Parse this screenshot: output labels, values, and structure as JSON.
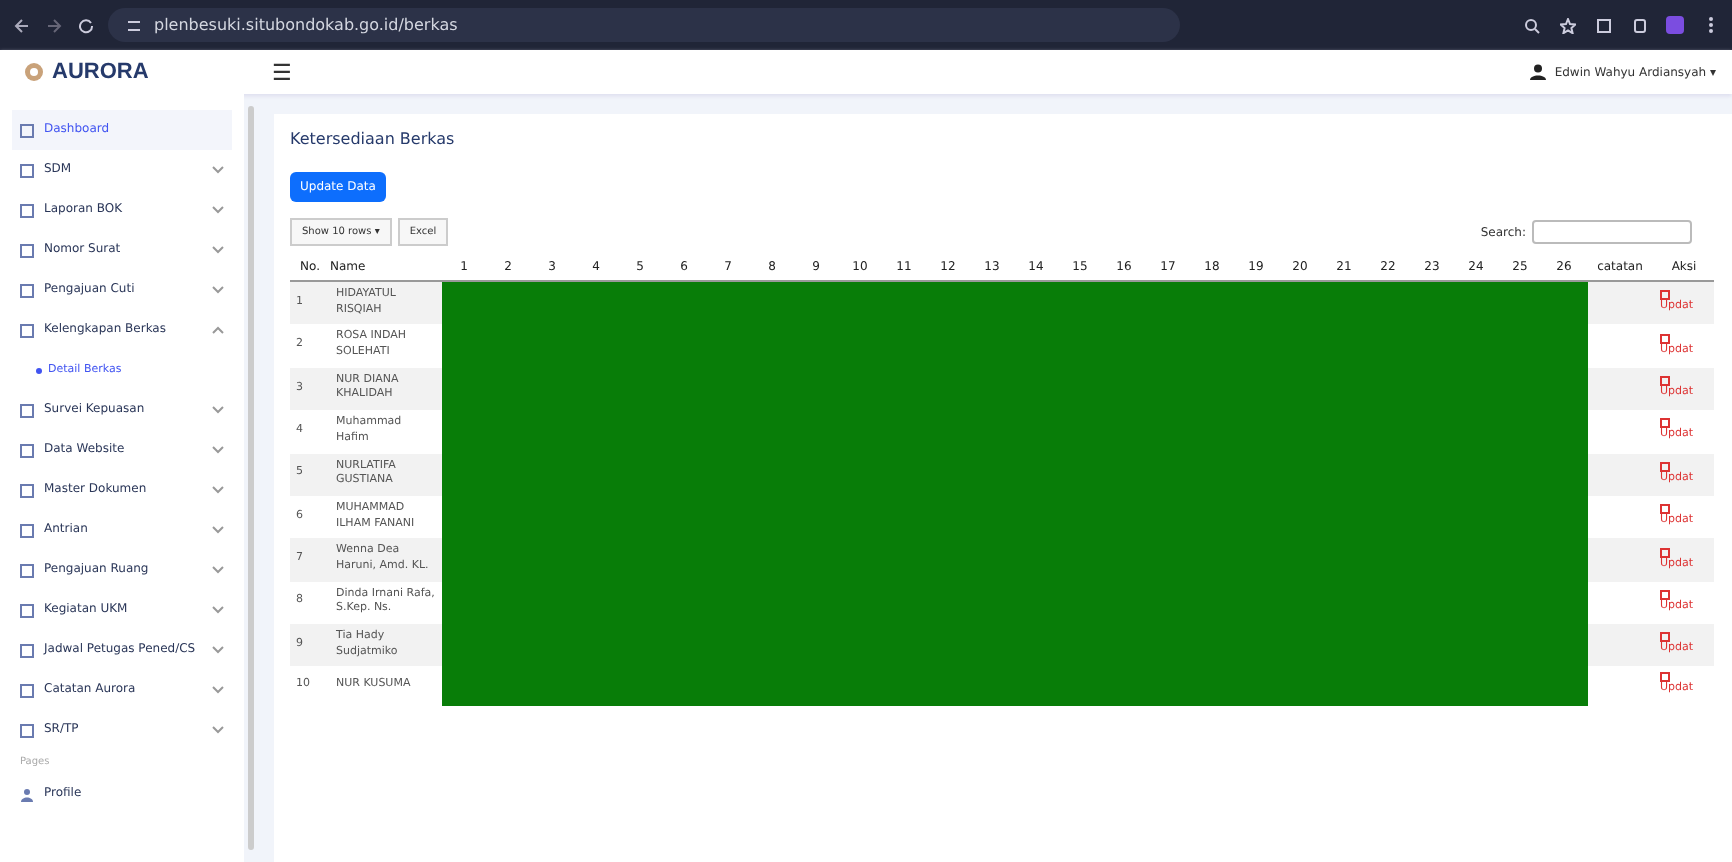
{
  "browser": {
    "url": "plenbesuki.situbondokab.go.id/berkas"
  },
  "app": {
    "logo": "AURORA",
    "menu_glyph": "☰",
    "user": "Edwin Wahyu Ardiansyah",
    "user_caret": "▾"
  },
  "sidebar": {
    "items": [
      {
        "label": "Dashboard",
        "selected": true
      },
      {
        "label": "SDM",
        "selected": false,
        "expanded": false
      },
      {
        "label": "Laporan BOK",
        "selected": false,
        "expanded": false
      },
      {
        "label": "Nomor Surat",
        "selected": false,
        "expanded": false
      },
      {
        "label": "Pengajuan Cuti",
        "selected": false,
        "expanded": false
      },
      {
        "label": "Kelengkapan Berkas",
        "selected": false,
        "expanded": true,
        "children": [
          {
            "label": "Detail Berkas",
            "selected": true
          }
        ]
      },
      {
        "label": "Survei Kepuasan",
        "selected": false,
        "expanded": false
      },
      {
        "label": "Data Website",
        "selected": false,
        "expanded": false
      },
      {
        "label": "Master Dokumen",
        "selected": false,
        "expanded": false
      },
      {
        "label": "Antrian",
        "selected": false,
        "expanded": false
      },
      {
        "label": "Pengajuan Ruang",
        "selected": false,
        "expanded": false
      },
      {
        "label": "Kegiatan UKM",
        "selected": false,
        "expanded": false
      },
      {
        "label": "Jadwal Petugas Pened/CS",
        "selected": false,
        "expanded": false
      },
      {
        "label": "Catatan Aurora",
        "selected": false,
        "expanded": false
      },
      {
        "label": "SR/TP",
        "selected": false,
        "expanded": false
      }
    ],
    "section_label": "Pages",
    "footer_items": [
      {
        "label": "Profile",
        "selected": false
      }
    ]
  },
  "content": {
    "title": "Ketersediaan Berkas",
    "update_button": "Update Data",
    "length_button": "Show 10 rows ▾",
    "excel_button": "Excel",
    "search_label": "Search:",
    "table": {
      "columns": [
        "No.",
        "Name",
        "1",
        "2",
        "3",
        "4",
        "5",
        "6",
        "7",
        "8",
        "9",
        "10",
        "11",
        "12",
        "13",
        "14",
        "15",
        "16",
        "17",
        "18",
        "19",
        "20",
        "21",
        "22",
        "23",
        "24",
        "25",
        "26",
        "catatan",
        "Aksi"
      ],
      "rows": [
        {
          "no": "1",
          "name": "HIDAYATUL RISQIAH",
          "complete": true,
          "action": "Updat"
        },
        {
          "no": "2",
          "name": "ROSA INDAH SOLEHATI",
          "complete": true,
          "action": "Updat"
        },
        {
          "no": "3",
          "name": "NUR DIANA KHALIDAH",
          "complete": true,
          "action": "Updat"
        },
        {
          "no": "4",
          "name": "Muhammad Hafim",
          "complete": true,
          "action": "Updat"
        },
        {
          "no": "5",
          "name": "NURLATIFA GUSTIANA",
          "complete": true,
          "action": "Updat"
        },
        {
          "no": "6",
          "name": "MUHAMMAD ILHAM FANANI",
          "complete": true,
          "action": "Updat"
        },
        {
          "no": "7",
          "name": "Wenna Dea Haruni, Amd. KL.",
          "complete": true,
          "action": "Updat"
        },
        {
          "no": "8",
          "name": "Dinda Irnani Rafa, S.Kep. Ns.",
          "complete": true,
          "action": "Updat"
        },
        {
          "no": "9",
          "name": "Tia Hady Sudjatmiko",
          "complete": true,
          "action": "Updat"
        },
        {
          "no": "10",
          "name": "NUR KUSUMA",
          "complete": true,
          "action": "Updat"
        }
      ]
    }
  }
}
